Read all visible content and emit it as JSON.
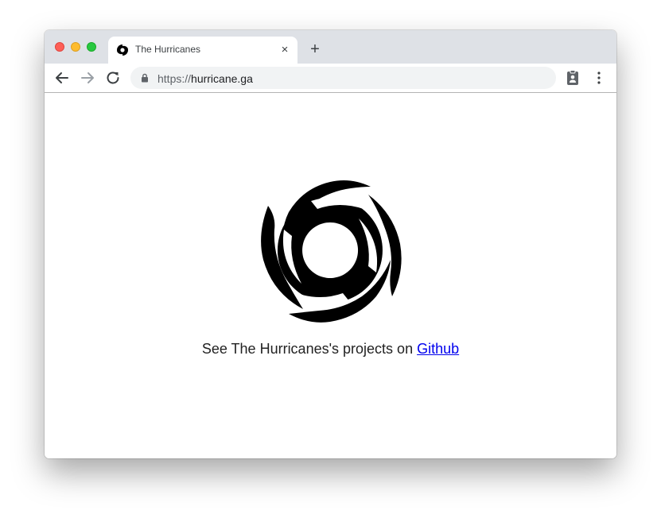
{
  "tab": {
    "title": "The Hurricanes",
    "favicon": "hurricane-icon",
    "close_label": "×"
  },
  "new_tab_label": "+",
  "toolbar": {
    "back": "arrow-left-icon",
    "forward": "arrow-right-icon",
    "reload": "reload-icon",
    "extension": "clipboard-account-icon",
    "menu": "kebab-menu-icon"
  },
  "address": {
    "scheme": "https://",
    "host": "hurricane.ga",
    "secure_icon": "lock-icon"
  },
  "page": {
    "logo": "hurricane-icon",
    "caption_prefix": "See The Hurricanes's projects on ",
    "link_text": "Github"
  },
  "colors": {
    "link": "#0000ee",
    "titlebar": "#dee1e6",
    "omnibox": "#f1f3f4"
  }
}
